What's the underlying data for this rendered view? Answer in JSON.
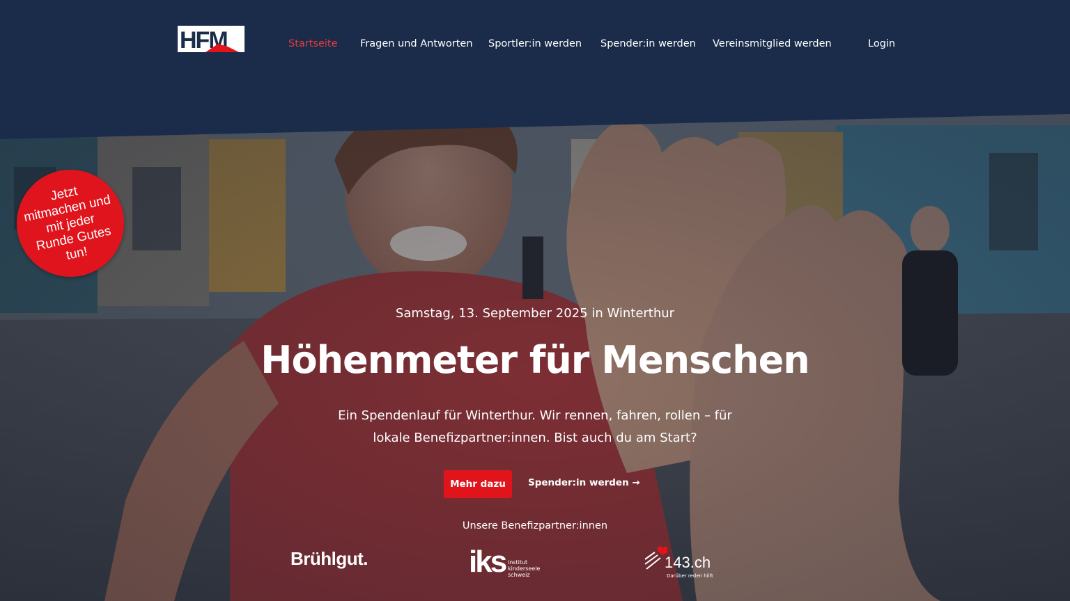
{
  "header": {
    "logo_alt": "HFM",
    "nav": [
      {
        "label": "Startseite",
        "active": true
      },
      {
        "label": "Fragen und Antworten",
        "active": false
      },
      {
        "label": "Sportler:in werden",
        "active": false
      },
      {
        "label": "Spender:in werden",
        "active": false
      },
      {
        "label": "Vereinsmitglied werden",
        "active": false
      }
    ],
    "login": "Login"
  },
  "badge": {
    "text": "Jetzt mitmachen und mit jeder Runde Gutes tun!"
  },
  "hero": {
    "date": "Samstag, 13. September 2025 in Winterthur",
    "title": "Höhenmeter für Menschen",
    "lead": "Ein Spendenlauf für Winterthur. Wir rennen, fahren, rollen – für lokale Benefizpartner:innen. Bist auch du am Start?",
    "primary_button": "Mehr dazu",
    "secondary_link": "Spender:in werden →"
  },
  "partners": {
    "label": "Unsere Benefizpartner:innen",
    "items": [
      {
        "name": "Brühlgut."
      },
      {
        "mark": "iks",
        "line1": "institut",
        "line2": "kinderseele",
        "line3": "schweiz"
      },
      {
        "name": "143.ch",
        "tagline": "Darüber reden hilft"
      }
    ]
  },
  "colors": {
    "header_bg": "#1b2c4b",
    "accent_red": "#e1141b",
    "active_nav": "#e23a3a"
  }
}
